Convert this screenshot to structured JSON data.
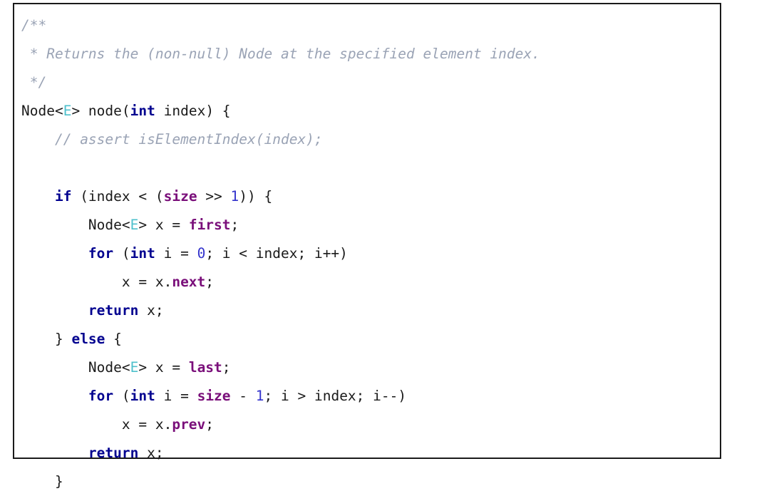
{
  "document": {
    "kind": "source-code-listing",
    "language": "Java",
    "border_color": "#1a1a1a",
    "background_color": "#ffffff",
    "colors": {
      "comment": "#9aa3b5",
      "keyword": "#00008f",
      "field": "#7a0f7a",
      "generic_type": "#4ec0cc",
      "number": "#3333cc",
      "plain": "#1a1a1a"
    }
  },
  "code": {
    "lines": [
      {
        "id": "line-1",
        "tokens": [
          {
            "t": "comment",
            "v": "/**"
          }
        ]
      },
      {
        "id": "line-2",
        "tokens": [
          {
            "t": "comment",
            "v": " * Returns the (non-null) Node at the specified element index."
          }
        ]
      },
      {
        "id": "line-3",
        "tokens": [
          {
            "t": "comment",
            "v": " */"
          }
        ]
      },
      {
        "id": "line-4",
        "tokens": [
          {
            "t": "plain",
            "v": "Node<"
          },
          {
            "t": "generic",
            "v": "E"
          },
          {
            "t": "plain",
            "v": "> node("
          },
          {
            "t": "keyword",
            "v": "int"
          },
          {
            "t": "plain",
            "v": " index) {"
          }
        ]
      },
      {
        "id": "line-5",
        "tokens": [
          {
            "t": "plain",
            "v": "    "
          },
          {
            "t": "comment",
            "v": "// assert isElementIndex(index);"
          }
        ]
      },
      {
        "id": "line-6",
        "tokens": [
          {
            "t": "plain",
            "v": ""
          }
        ]
      },
      {
        "id": "line-7",
        "tokens": [
          {
            "t": "plain",
            "v": "    "
          },
          {
            "t": "keyword",
            "v": "if"
          },
          {
            "t": "plain",
            "v": " (index < ("
          },
          {
            "t": "field",
            "v": "size"
          },
          {
            "t": "plain",
            "v": " >> "
          },
          {
            "t": "number",
            "v": "1"
          },
          {
            "t": "plain",
            "v": ")) {"
          }
        ]
      },
      {
        "id": "line-8",
        "tokens": [
          {
            "t": "plain",
            "v": "        Node<"
          },
          {
            "t": "generic",
            "v": "E"
          },
          {
            "t": "plain",
            "v": "> x = "
          },
          {
            "t": "field",
            "v": "first"
          },
          {
            "t": "plain",
            "v": ";"
          }
        ]
      },
      {
        "id": "line-9",
        "tokens": [
          {
            "t": "plain",
            "v": "        "
          },
          {
            "t": "keyword",
            "v": "for"
          },
          {
            "t": "plain",
            "v": " ("
          },
          {
            "t": "keyword",
            "v": "int"
          },
          {
            "t": "plain",
            "v": " i = "
          },
          {
            "t": "number",
            "v": "0"
          },
          {
            "t": "plain",
            "v": "; i < index; i++)"
          }
        ]
      },
      {
        "id": "line-10",
        "tokens": [
          {
            "t": "plain",
            "v": "            x = x."
          },
          {
            "t": "field",
            "v": "next"
          },
          {
            "t": "plain",
            "v": ";"
          }
        ]
      },
      {
        "id": "line-11",
        "tokens": [
          {
            "t": "plain",
            "v": "        "
          },
          {
            "t": "keyword",
            "v": "return"
          },
          {
            "t": "plain",
            "v": " x;"
          }
        ]
      },
      {
        "id": "line-12",
        "tokens": [
          {
            "t": "plain",
            "v": "    } "
          },
          {
            "t": "keyword",
            "v": "else"
          },
          {
            "t": "plain",
            "v": " {"
          }
        ]
      },
      {
        "id": "line-13",
        "tokens": [
          {
            "t": "plain",
            "v": "        Node<"
          },
          {
            "t": "generic",
            "v": "E"
          },
          {
            "t": "plain",
            "v": "> x = "
          },
          {
            "t": "field",
            "v": "last"
          },
          {
            "t": "plain",
            "v": ";"
          }
        ]
      },
      {
        "id": "line-14",
        "tokens": [
          {
            "t": "plain",
            "v": "        "
          },
          {
            "t": "keyword",
            "v": "for"
          },
          {
            "t": "plain",
            "v": " ("
          },
          {
            "t": "keyword",
            "v": "int"
          },
          {
            "t": "plain",
            "v": " i = "
          },
          {
            "t": "field",
            "v": "size"
          },
          {
            "t": "plain",
            "v": " - "
          },
          {
            "t": "number",
            "v": "1"
          },
          {
            "t": "plain",
            "v": "; i > index; i--)"
          }
        ]
      },
      {
        "id": "line-15",
        "tokens": [
          {
            "t": "plain",
            "v": "            x = x."
          },
          {
            "t": "field",
            "v": "prev"
          },
          {
            "t": "plain",
            "v": ";"
          }
        ]
      },
      {
        "id": "line-16",
        "tokens": [
          {
            "t": "plain",
            "v": "        "
          },
          {
            "t": "keyword",
            "v": "return"
          },
          {
            "t": "plain",
            "v": " x;"
          }
        ]
      },
      {
        "id": "line-17",
        "tokens": [
          {
            "t": "plain",
            "v": "    }"
          }
        ]
      }
    ]
  }
}
